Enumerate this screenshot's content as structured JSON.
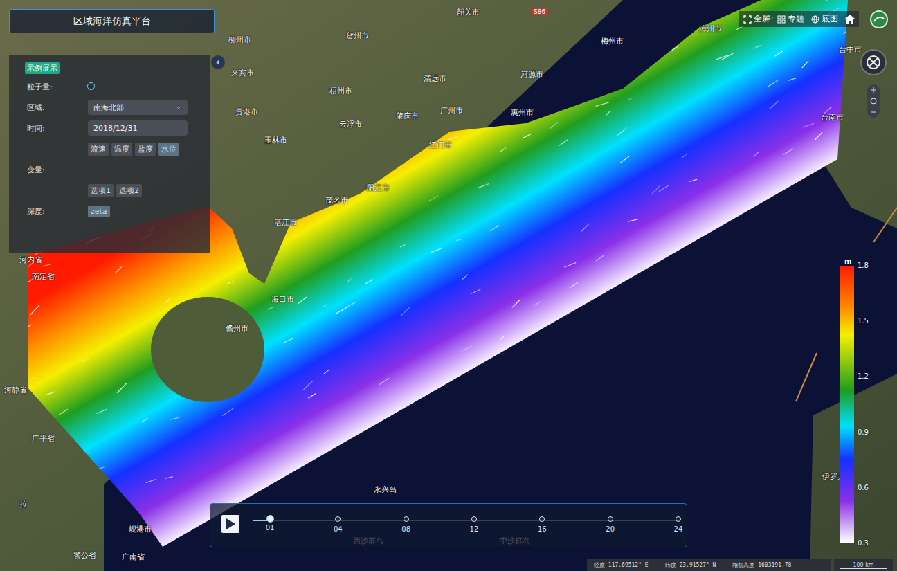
{
  "app_title": "区域海洋仿真平台",
  "toolbar": [
    {
      "label": "全屏"
    },
    {
      "label": "专题"
    },
    {
      "label": "底图"
    }
  ],
  "panel": {
    "tag": "示例展示",
    "particles": {
      "label": "粒子量:",
      "level": 0
    },
    "region": {
      "label": "区域:",
      "value": "南海北部"
    },
    "time": {
      "label": "时间:",
      "value": "2018/12/31"
    },
    "variables": [
      {
        "label": "流速",
        "selected": false
      },
      {
        "label": "温度",
        "selected": false
      },
      {
        "label": "盐度",
        "selected": false
      },
      {
        "label": "水位",
        "selected": true
      }
    ],
    "variable_label": "变量:",
    "options": [
      {
        "label": "选项1",
        "selected": false
      },
      {
        "label": "选项2",
        "selected": false
      }
    ],
    "depth": {
      "label": "深度:",
      "value": "zeta"
    }
  },
  "legend": {
    "unit": "m",
    "ticks": [
      "1.8",
      "1.5",
      "1.2",
      "0.9",
      "0.6",
      "0.3"
    ]
  },
  "timeline": {
    "level": 0,
    "ticks": [
      {
        "label": "01",
        "selected": true
      },
      {
        "label": "04",
        "selected": false
      },
      {
        "label": "08",
        "selected": false
      },
      {
        "label": "12",
        "selected": false
      },
      {
        "label": "16",
        "selected": false
      },
      {
        "label": "20",
        "selected": false
      },
      {
        "label": "24",
        "selected": false
      }
    ]
  },
  "status": {
    "lon_label": "经度",
    "lon": "117.69512° E",
    "lat_label": "纬度",
    "lat": "23.91527° N",
    "cam_label": "相机高度",
    "cam": "1603191.78",
    "scale": "100 km"
  },
  "road_badges": [
    "S86"
  ],
  "map_labels": [
    "贺州市",
    "韶关市",
    "梅州市",
    "漳州市",
    "柳州市",
    "河源市",
    "清远市",
    "梧州市",
    "来宾市",
    "广州市",
    "惠州市",
    "肇庆市",
    "贵港市",
    "云浮市",
    "玉林市",
    "江门市",
    "阳江市",
    "茂名市",
    "湛江市",
    "海口市",
    "儋州市",
    "河内省",
    "南定省",
    "河静省",
    "广平省",
    "岘港市",
    "广南省",
    "警公省",
    "拉",
    "永兴岛",
    "西沙群岛",
    "中沙群岛",
    "台中市",
    "台南市",
    "伊罗戈"
  ]
}
